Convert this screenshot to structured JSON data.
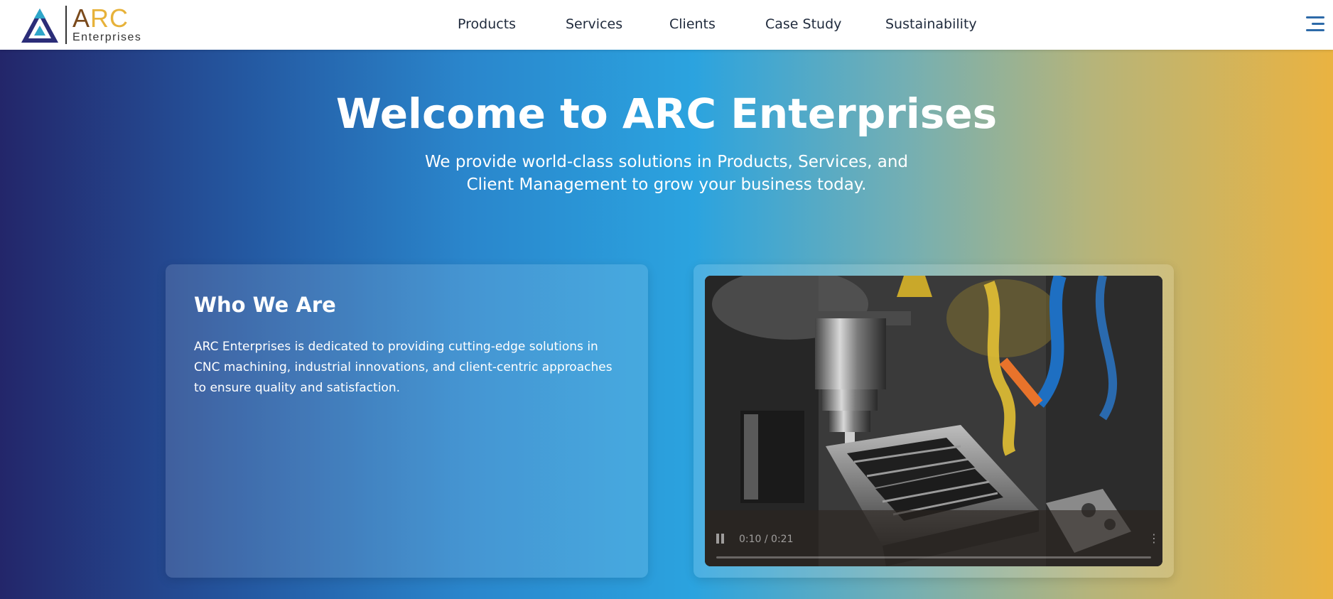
{
  "brand": {
    "logo_text_a": "A",
    "logo_text_rc": "RC",
    "logo_sub": "Enterprises",
    "colors": {
      "triangle_outer": "#2b2d78",
      "triangle_inner": "#2ea6c9",
      "arc_a": "#7a4a1c",
      "arc_rc": "#e7b23a"
    }
  },
  "nav": {
    "items": [
      {
        "label": "Products"
      },
      {
        "label": "Services"
      },
      {
        "label": "Clients"
      },
      {
        "label": "Case Study"
      },
      {
        "label": "Sustainability"
      }
    ],
    "menu_icon": "hamburger-menu-icon"
  },
  "hero": {
    "title": "Welcome to ARC Enterprises",
    "subtitle": "We provide world-class solutions in Products, Services, and Client Management to grow your business today."
  },
  "about": {
    "heading": "Who We Are",
    "body": "ARC Enterprises is dedicated to providing cutting-edge solutions in CNC machining, industrial innovations, and client-centric approaches to ensure quality and satisfaction."
  },
  "video": {
    "time": "0:10 / 0:21",
    "progress": 0.0,
    "play_icon": "pause-icon",
    "more_icon": "more-options-icon"
  }
}
